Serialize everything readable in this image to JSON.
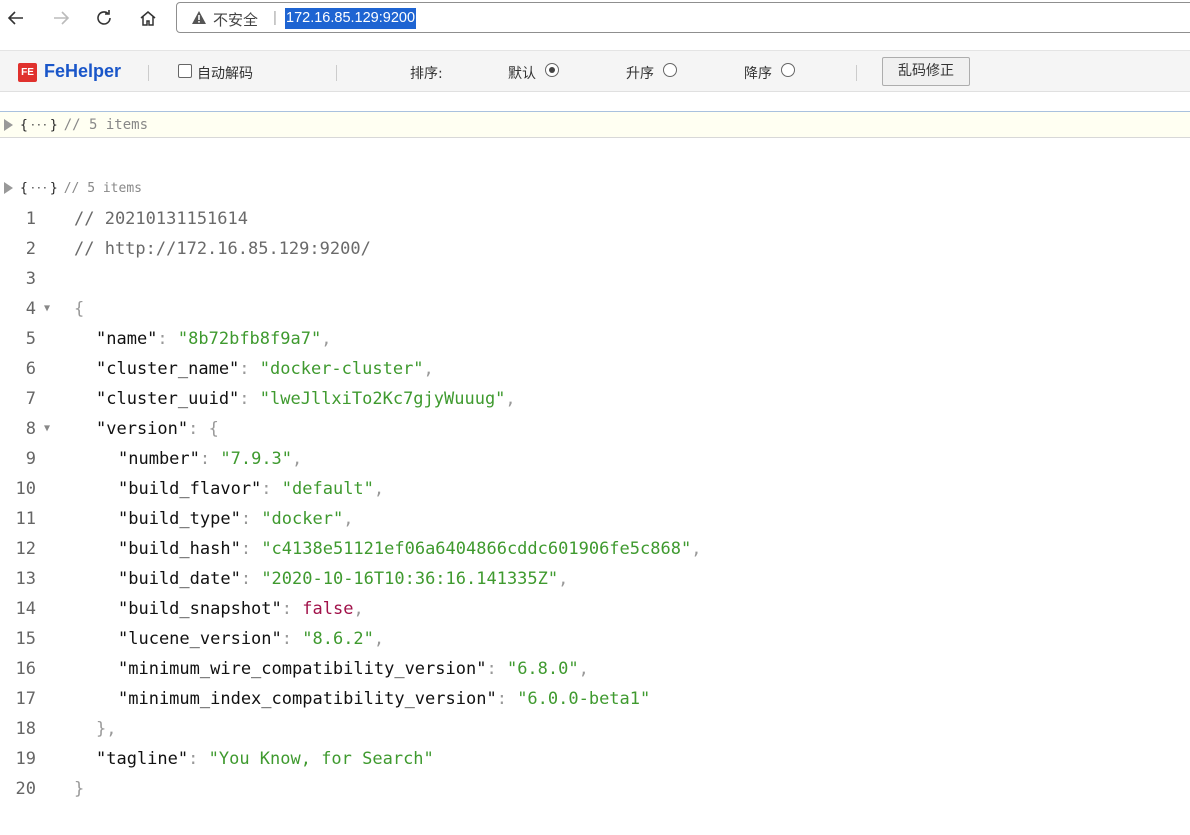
{
  "browser": {
    "insecure_label": "不安全",
    "separator": "|",
    "url": "172.16.85.129:9200"
  },
  "fehelper": {
    "brand_logo": "FE",
    "brand": "FeHelper",
    "auto_decode_label": "自动解码",
    "sort_label": "排序:",
    "sort_options": [
      {
        "label": "默认",
        "checked": true
      },
      {
        "label": "升序",
        "checked": false
      },
      {
        "label": "降序",
        "checked": false
      }
    ],
    "fix_button": "乱码修正"
  },
  "summary": {
    "open_brace": "{",
    "close_brace": "}",
    "ellipsis": "···",
    "count_text": "// 5 items"
  },
  "json_lines": [
    {
      "n": "1",
      "fold": "",
      "indent": 0,
      "parts": [
        {
          "t": "// 20210131151614",
          "c": "cm"
        }
      ]
    },
    {
      "n": "2",
      "fold": "",
      "indent": 0,
      "parts": [
        {
          "t": "// http://172.16.85.129:9200/",
          "c": "cm"
        }
      ]
    },
    {
      "n": "3",
      "fold": "",
      "indent": 0,
      "parts": []
    },
    {
      "n": "4",
      "fold": "▼",
      "indent": 0,
      "parts": [
        {
          "t": "{",
          "c": "pun"
        }
      ]
    },
    {
      "n": "5",
      "fold": "",
      "indent": 1,
      "parts": [
        {
          "t": "\"name\"",
          "c": "key"
        },
        {
          "t": ": ",
          "c": "pun"
        },
        {
          "t": "\"8b72bfb8f9a7\"",
          "c": "str"
        },
        {
          "t": ",",
          "c": "pun"
        }
      ]
    },
    {
      "n": "6",
      "fold": "",
      "indent": 1,
      "parts": [
        {
          "t": "\"cluster_name\"",
          "c": "key"
        },
        {
          "t": ": ",
          "c": "pun"
        },
        {
          "t": "\"docker-cluster\"",
          "c": "str"
        },
        {
          "t": ",",
          "c": "pun"
        }
      ]
    },
    {
      "n": "7",
      "fold": "",
      "indent": 1,
      "parts": [
        {
          "t": "\"cluster_uuid\"",
          "c": "key"
        },
        {
          "t": ": ",
          "c": "pun"
        },
        {
          "t": "\"lweJllxiTo2Kc7gjyWuuug\"",
          "c": "str"
        },
        {
          "t": ",",
          "c": "pun"
        }
      ]
    },
    {
      "n": "8",
      "fold": "▼",
      "indent": 1,
      "parts": [
        {
          "t": "\"version\"",
          "c": "key"
        },
        {
          "t": ": {",
          "c": "pun"
        }
      ]
    },
    {
      "n": "9",
      "fold": "",
      "indent": 2,
      "parts": [
        {
          "t": "\"number\"",
          "c": "key"
        },
        {
          "t": ": ",
          "c": "pun"
        },
        {
          "t": "\"7.9.3\"",
          "c": "str"
        },
        {
          "t": ",",
          "c": "pun"
        }
      ]
    },
    {
      "n": "10",
      "fold": "",
      "indent": 2,
      "parts": [
        {
          "t": "\"build_flavor\"",
          "c": "key"
        },
        {
          "t": ": ",
          "c": "pun"
        },
        {
          "t": "\"default\"",
          "c": "str"
        },
        {
          "t": ",",
          "c": "pun"
        }
      ]
    },
    {
      "n": "11",
      "fold": "",
      "indent": 2,
      "parts": [
        {
          "t": "\"build_type\"",
          "c": "key"
        },
        {
          "t": ": ",
          "c": "pun"
        },
        {
          "t": "\"docker\"",
          "c": "str"
        },
        {
          "t": ",",
          "c": "pun"
        }
      ]
    },
    {
      "n": "12",
      "fold": "",
      "indent": 2,
      "parts": [
        {
          "t": "\"build_hash\"",
          "c": "key"
        },
        {
          "t": ": ",
          "c": "pun"
        },
        {
          "t": "\"c4138e51121ef06a6404866cddc601906fe5c868\"",
          "c": "str"
        },
        {
          "t": ",",
          "c": "pun"
        }
      ]
    },
    {
      "n": "13",
      "fold": "",
      "indent": 2,
      "parts": [
        {
          "t": "\"build_date\"",
          "c": "key"
        },
        {
          "t": ": ",
          "c": "pun"
        },
        {
          "t": "\"2020-10-16T10:36:16.141335Z\"",
          "c": "str"
        },
        {
          "t": ",",
          "c": "pun"
        }
      ]
    },
    {
      "n": "14",
      "fold": "",
      "indent": 2,
      "parts": [
        {
          "t": "\"build_snapshot\"",
          "c": "key"
        },
        {
          "t": ": ",
          "c": "pun"
        },
        {
          "t": "false",
          "c": "bool"
        },
        {
          "t": ",",
          "c": "pun"
        }
      ]
    },
    {
      "n": "15",
      "fold": "",
      "indent": 2,
      "parts": [
        {
          "t": "\"lucene_version\"",
          "c": "key"
        },
        {
          "t": ": ",
          "c": "pun"
        },
        {
          "t": "\"8.6.2\"",
          "c": "str"
        },
        {
          "t": ",",
          "c": "pun"
        }
      ]
    },
    {
      "n": "16",
      "fold": "",
      "indent": 2,
      "parts": [
        {
          "t": "\"minimum_wire_compatibility_version\"",
          "c": "key"
        },
        {
          "t": ": ",
          "c": "pun"
        },
        {
          "t": "\"6.8.0\"",
          "c": "str"
        },
        {
          "t": ",",
          "c": "pun"
        }
      ]
    },
    {
      "n": "17",
      "fold": "",
      "indent": 2,
      "parts": [
        {
          "t": "\"minimum_index_compatibility_version\"",
          "c": "key"
        },
        {
          "t": ": ",
          "c": "pun"
        },
        {
          "t": "\"6.0.0-beta1\"",
          "c": "str"
        }
      ]
    },
    {
      "n": "18",
      "fold": "",
      "indent": 1,
      "parts": [
        {
          "t": "},",
          "c": "pun"
        }
      ]
    },
    {
      "n": "19",
      "fold": "",
      "indent": 1,
      "parts": [
        {
          "t": "\"tagline\"",
          "c": "key"
        },
        {
          "t": ": ",
          "c": "pun"
        },
        {
          "t": "\"You Know, for Search\"",
          "c": "str"
        }
      ]
    },
    {
      "n": "20",
      "fold": "",
      "indent": 0,
      "parts": [
        {
          "t": "}",
          "c": "pun"
        }
      ]
    }
  ]
}
